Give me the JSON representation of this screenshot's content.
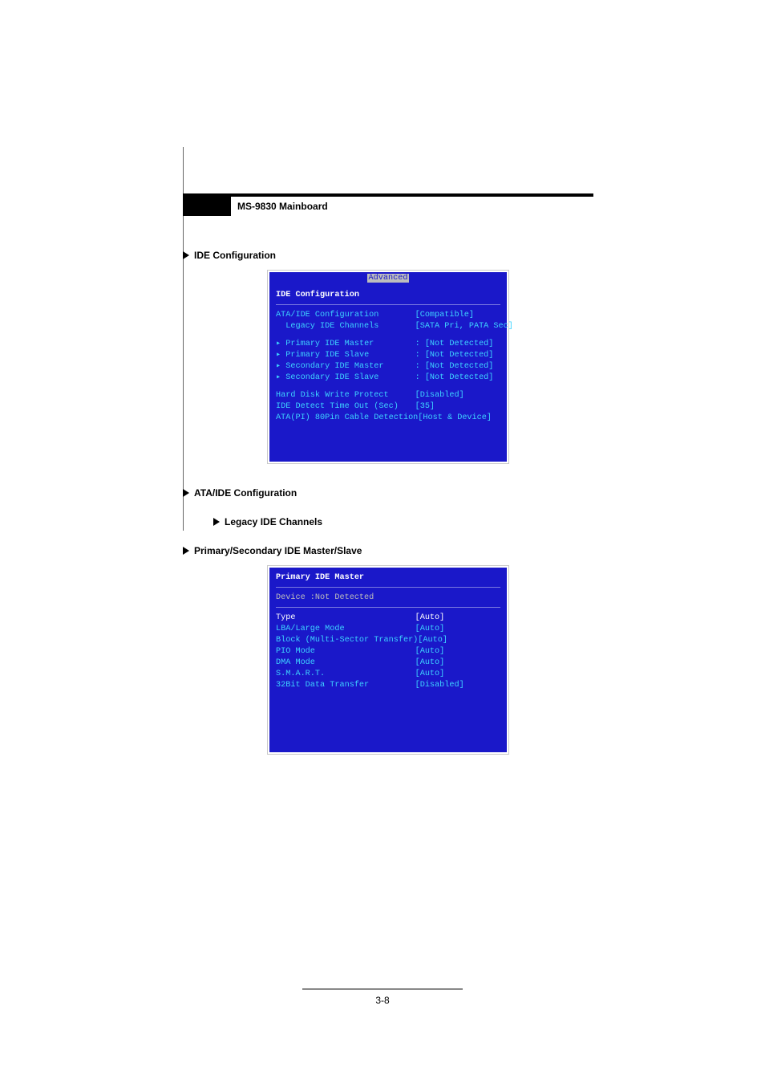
{
  "header": {
    "title": "MS-9830 Mainboard"
  },
  "sections": {
    "ide_config": "IDE Configuration",
    "ata_ide_config": "ATA/IDE Configuration",
    "legacy_ide_channels": "Legacy IDE Channels",
    "primary_secondary": "Primary/Secondary IDE Master/Slave"
  },
  "bios1": {
    "tab": "Advanced",
    "title": "IDE Configuration",
    "rows": [
      {
        "label": "ATA/IDE Configuration",
        "value": "[Compatible]"
      },
      {
        "label": "  Legacy IDE Channels",
        "value": "[SATA Pri, PATA Sec]"
      }
    ],
    "drives": [
      {
        "label": "▸ Primary IDE Master",
        "value": ": [Not Detected]"
      },
      {
        "label": "▸ Primary IDE Slave",
        "value": ": [Not Detected]"
      },
      {
        "label": "▸ Secondary IDE Master",
        "value": ": [Not Detected]"
      },
      {
        "label": "▸ Secondary IDE Slave",
        "value": ": [Not Detected]"
      }
    ],
    "opts": [
      {
        "label": "Hard Disk Write Protect",
        "value": "[Disabled]"
      },
      {
        "label": "IDE Detect Time Out (Sec)",
        "value": "[35]"
      },
      {
        "label": "ATA(PI) 80Pin Cable Detection",
        "value": "[Host & Device]"
      }
    ]
  },
  "bios2": {
    "title": "Primary IDE Master",
    "device_line": "Device   :Not Detected",
    "rows": [
      {
        "label": "Type",
        "value": "[Auto]",
        "white": true
      },
      {
        "label": "LBA/Large Mode",
        "value": "[Auto]"
      },
      {
        "label": "Block (Multi-Sector Transfer)",
        "value": "[Auto]"
      },
      {
        "label": "PIO Mode",
        "value": "[Auto]"
      },
      {
        "label": "DMA Mode",
        "value": "[Auto]"
      },
      {
        "label": "S.M.A.R.T.",
        "value": "[Auto]"
      },
      {
        "label": "32Bit Data Transfer",
        "value": "[Disabled]"
      }
    ]
  },
  "footer": {
    "page": "3-8"
  }
}
